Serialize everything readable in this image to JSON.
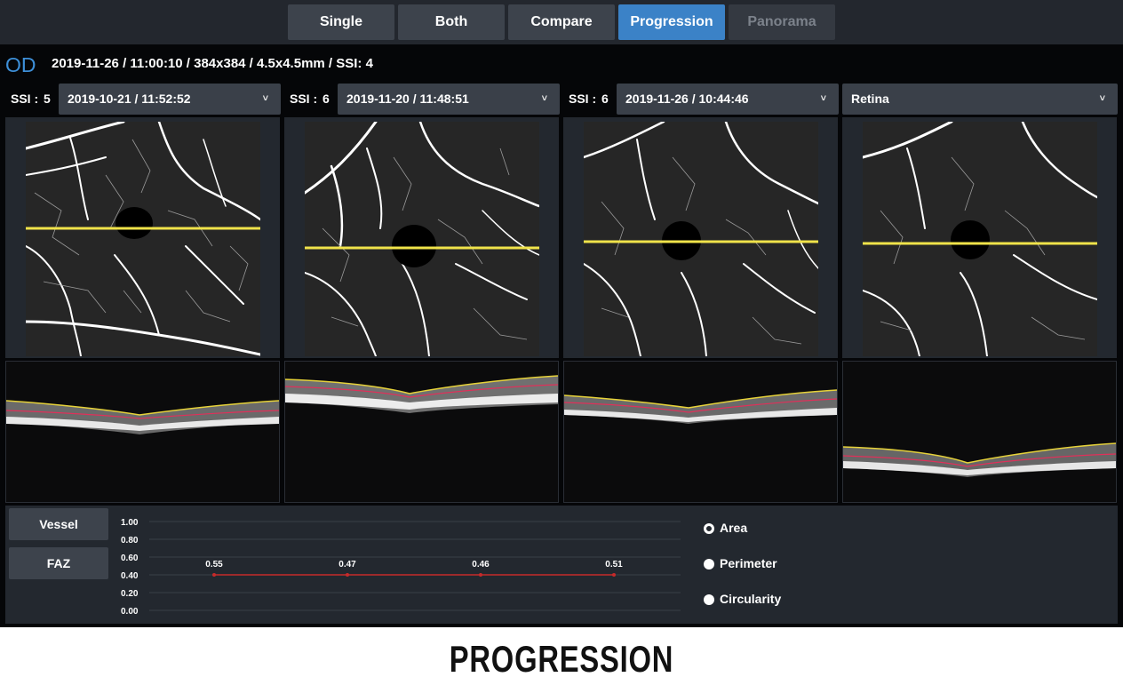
{
  "tabs": [
    {
      "label": "Single",
      "state": "normal"
    },
    {
      "label": "Both",
      "state": "normal"
    },
    {
      "label": "Compare",
      "state": "normal"
    },
    {
      "label": "Progression",
      "state": "active"
    },
    {
      "label": "Panorama",
      "state": "disabled"
    }
  ],
  "header": {
    "eye": "OD",
    "scan_info": "2019-11-26 / 11:00:10 / 384x384 / 4.5x4.5mm / SSI: 4"
  },
  "visits": [
    {
      "ssi_label": "SSI :",
      "ssi_value": "5",
      "date": "2019-10-21 / 11:52:52"
    },
    {
      "ssi_label": "SSI :",
      "ssi_value": "6",
      "date": "2019-11-20 / 11:48:51"
    },
    {
      "ssi_label": "SSI :",
      "ssi_value": "6",
      "date": "2019-11-26 / 10:44:46"
    }
  ],
  "layer_select": {
    "value": "Retina"
  },
  "metric_buttons": {
    "vessel": "Vessel",
    "faz": "FAZ"
  },
  "metric_options": [
    {
      "label": "Area",
      "selected": true
    },
    {
      "label": "Perimeter",
      "selected": false
    },
    {
      "label": "Circularity",
      "selected": false
    }
  ],
  "chart_data": {
    "type": "line",
    "y_ticks": [
      "1.00",
      "0.80",
      "0.60",
      "0.40",
      "0.20",
      "0.00"
    ],
    "ylim": [
      0,
      1
    ],
    "values": [
      0.4,
      0.4,
      0.4,
      0.4
    ],
    "data_labels": [
      "0.55",
      "0.47",
      "0.46",
      "0.51"
    ],
    "series_color": "#c62a2a",
    "grid": true
  },
  "colors": {
    "accent": "#3b82c7",
    "scan_line": "#f0e34a",
    "ilm_line": "#e6d23a",
    "layer_line": "#e0305a"
  },
  "caption": "PROGRESSION"
}
